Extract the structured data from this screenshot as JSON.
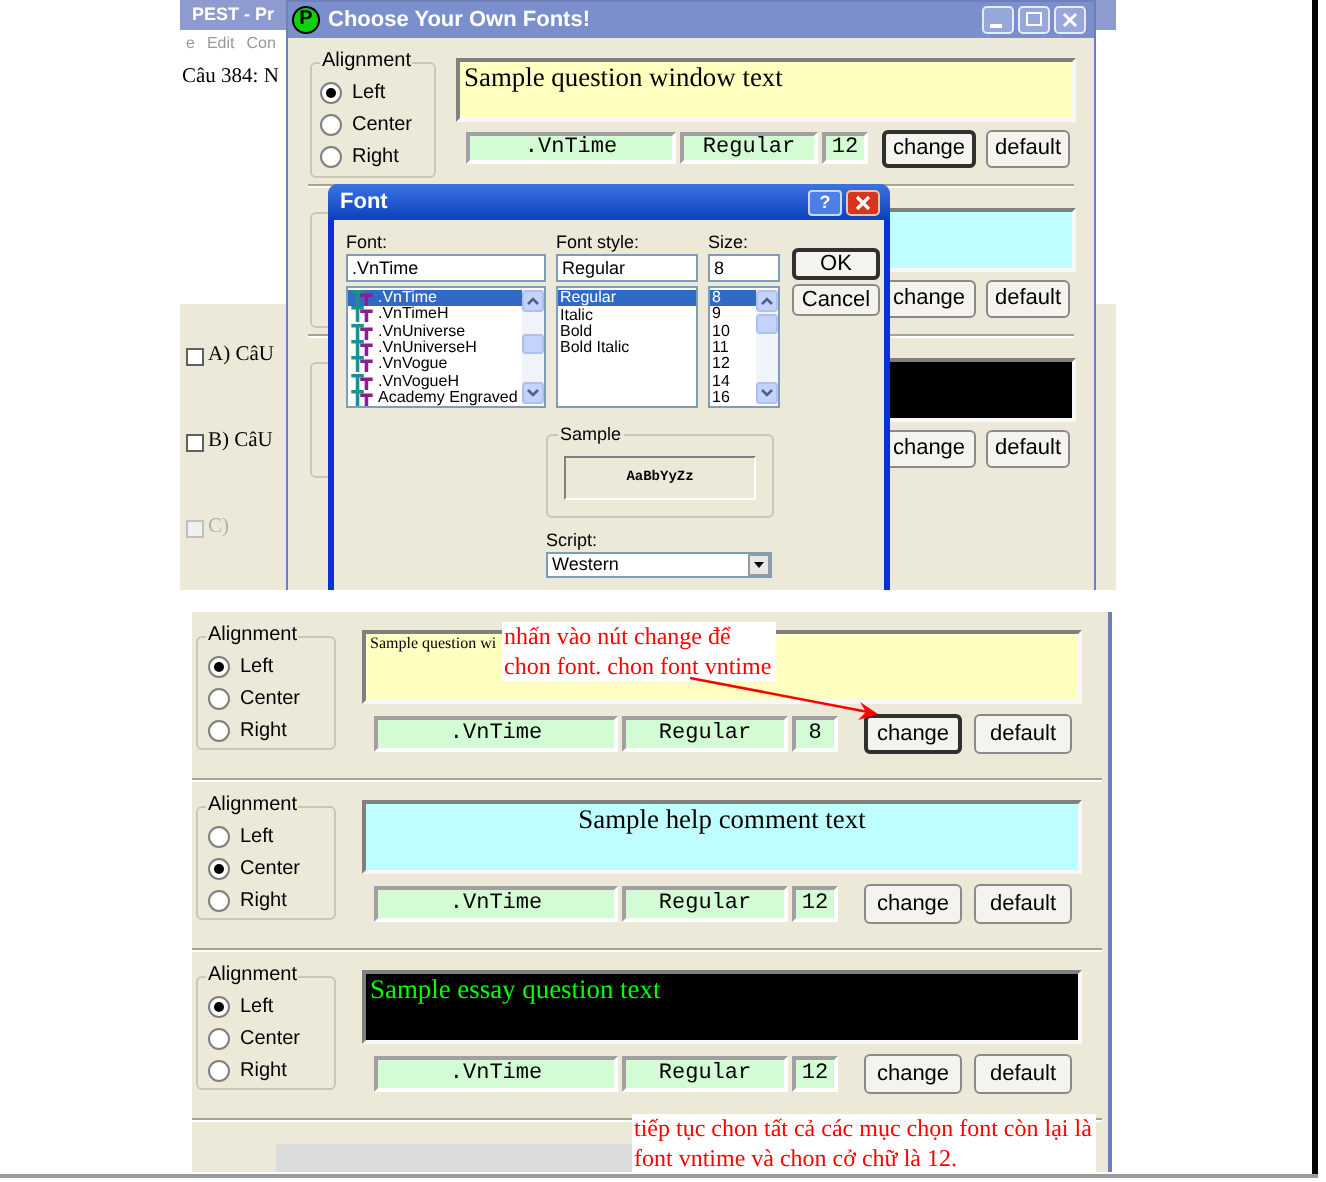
{
  "top_screenshot": {
    "background_window": {
      "title": "PEST - Pr",
      "menu": [
        "e",
        "Edit",
        "Con"
      ],
      "question": "Câu 384: N",
      "answers": [
        {
          "label": "A) CâU",
          "checked": false,
          "disabled": false
        },
        {
          "label": "B) CâU",
          "checked": false,
          "disabled": false
        },
        {
          "label": "C)",
          "checked": false,
          "disabled": true
        }
      ]
    },
    "fonts_window": {
      "icon_letter": "P",
      "title": "Choose Your Own Fonts!",
      "sections": [
        {
          "alignment": {
            "label": "Alignment",
            "options": [
              {
                "label": "Left",
                "selected": true
              },
              {
                "label": "Center",
                "selected": false
              },
              {
                "label": "Right",
                "selected": false
              }
            ]
          },
          "sample": {
            "text": {
              "label": "Sample question window text",
              "color": "#000000"
            },
            "color": "#ffffc0"
          },
          "font": {
            "name": ".VnTime",
            "style": "Regular",
            "size": "12"
          },
          "buttons": [
            {
              "label": "change",
              "focused": true
            },
            {
              "label": "default",
              "focused": false
            }
          ]
        },
        {
          "sample": {
            "color": "#c0ffff"
          },
          "buttons": [
            {
              "label": "change",
              "focused": false
            },
            {
              "label": "default",
              "focused": false
            }
          ]
        },
        {
          "sample": {
            "color": "#000000"
          },
          "buttons": [
            {
              "label": "change",
              "focused": false
            },
            {
              "label": "default",
              "focused": false
            }
          ]
        }
      ]
    },
    "font_dialog": {
      "title": "Font",
      "help": "?",
      "font_label": "Font:",
      "font_value": ".VnTime",
      "fonts": [
        {
          "label": ".VnTime",
          "selected": true
        },
        {
          "label": ".VnTimeH",
          "selected": false
        },
        {
          "label": ".VnUniverse",
          "selected": false
        },
        {
          "label": ".VnUniverseH",
          "selected": false
        },
        {
          "label": ".VnVogue",
          "selected": false
        },
        {
          "label": ".VnVogueH",
          "selected": false
        },
        {
          "label": "Academy Engraved",
          "selected": false
        }
      ],
      "style_label": "Font style:",
      "style_value": "Regular",
      "styles": [
        {
          "label": "Regular",
          "selected": true
        },
        {
          "label": "Italic",
          "selected": false
        },
        {
          "label": "Bold",
          "selected": false
        },
        {
          "label": "Bold Italic",
          "selected": false
        }
      ],
      "size_label": "Size:",
      "size_value": "8",
      "sizes": [
        {
          "label": "8",
          "selected": true
        },
        {
          "label": "9",
          "selected": false
        },
        {
          "label": "10",
          "selected": false
        },
        {
          "label": "11",
          "selected": false
        },
        {
          "label": "12",
          "selected": false
        },
        {
          "label": "14",
          "selected": false
        },
        {
          "label": "16",
          "selected": false
        }
      ],
      "buttons": [
        {
          "label": "OK",
          "focused": true
        },
        {
          "label": "Cancel",
          "focused": false
        }
      ],
      "sample_label": "Sample",
      "sample_text": "AaBbYyZz",
      "script_label": "Script:",
      "script_value": "Western"
    }
  },
  "bottom_screenshot": {
    "sections": [
      {
        "alignment": {
          "label": "Alignment",
          "options": [
            {
              "label": "Left",
              "selected": true
            },
            {
              "label": "Center",
              "selected": false
            },
            {
              "label": "Right",
              "selected": false
            }
          ]
        },
        "sample": {
          "text": {
            "label": "Sample question wi",
            "color": "#000000"
          },
          "color": "#ffffc0"
        },
        "font": {
          "name": ".VnTime",
          "style": "Regular",
          "size": "8"
        },
        "buttons": [
          {
            "label": "change",
            "focused": true
          },
          {
            "label": "default",
            "focused": false
          }
        ]
      },
      {
        "alignment": {
          "label": "Alignment",
          "options": [
            {
              "label": "Left",
              "selected": false
            },
            {
              "label": "Center",
              "selected": true
            },
            {
              "label": "Right",
              "selected": false
            }
          ]
        },
        "sample": {
          "text": {
            "label": "Sample help comment text",
            "color": "#000000"
          },
          "color": "#c0ffff"
        },
        "font": {
          "name": ".VnTime",
          "style": "Regular",
          "size": "12"
        },
        "buttons": [
          {
            "label": "change",
            "focused": false
          },
          {
            "label": "default",
            "focused": false
          }
        ]
      },
      {
        "alignment": {
          "label": "Alignment",
          "options": [
            {
              "label": "Left",
              "selected": true
            },
            {
              "label": "Center",
              "selected": false
            },
            {
              "label": "Right",
              "selected": false
            }
          ]
        },
        "sample": {
          "text": {
            "label": "Sample essay question text",
            "color": "#00ff00"
          },
          "color": "#000000"
        },
        "font": {
          "name": ".VnTime",
          "style": "Regular",
          "size": "12"
        },
        "buttons": [
          {
            "label": "change",
            "focused": false
          },
          {
            "label": "default",
            "focused": false
          }
        ]
      }
    ],
    "notes": [
      {
        "text": "nhấn vào nút change để\nchon font. chon font vntime"
      },
      {
        "text": "tiếp tục chon tất cả các mục chọn font còn lại là\nfont vntime và chon cở chữ là 12."
      }
    ]
  }
}
